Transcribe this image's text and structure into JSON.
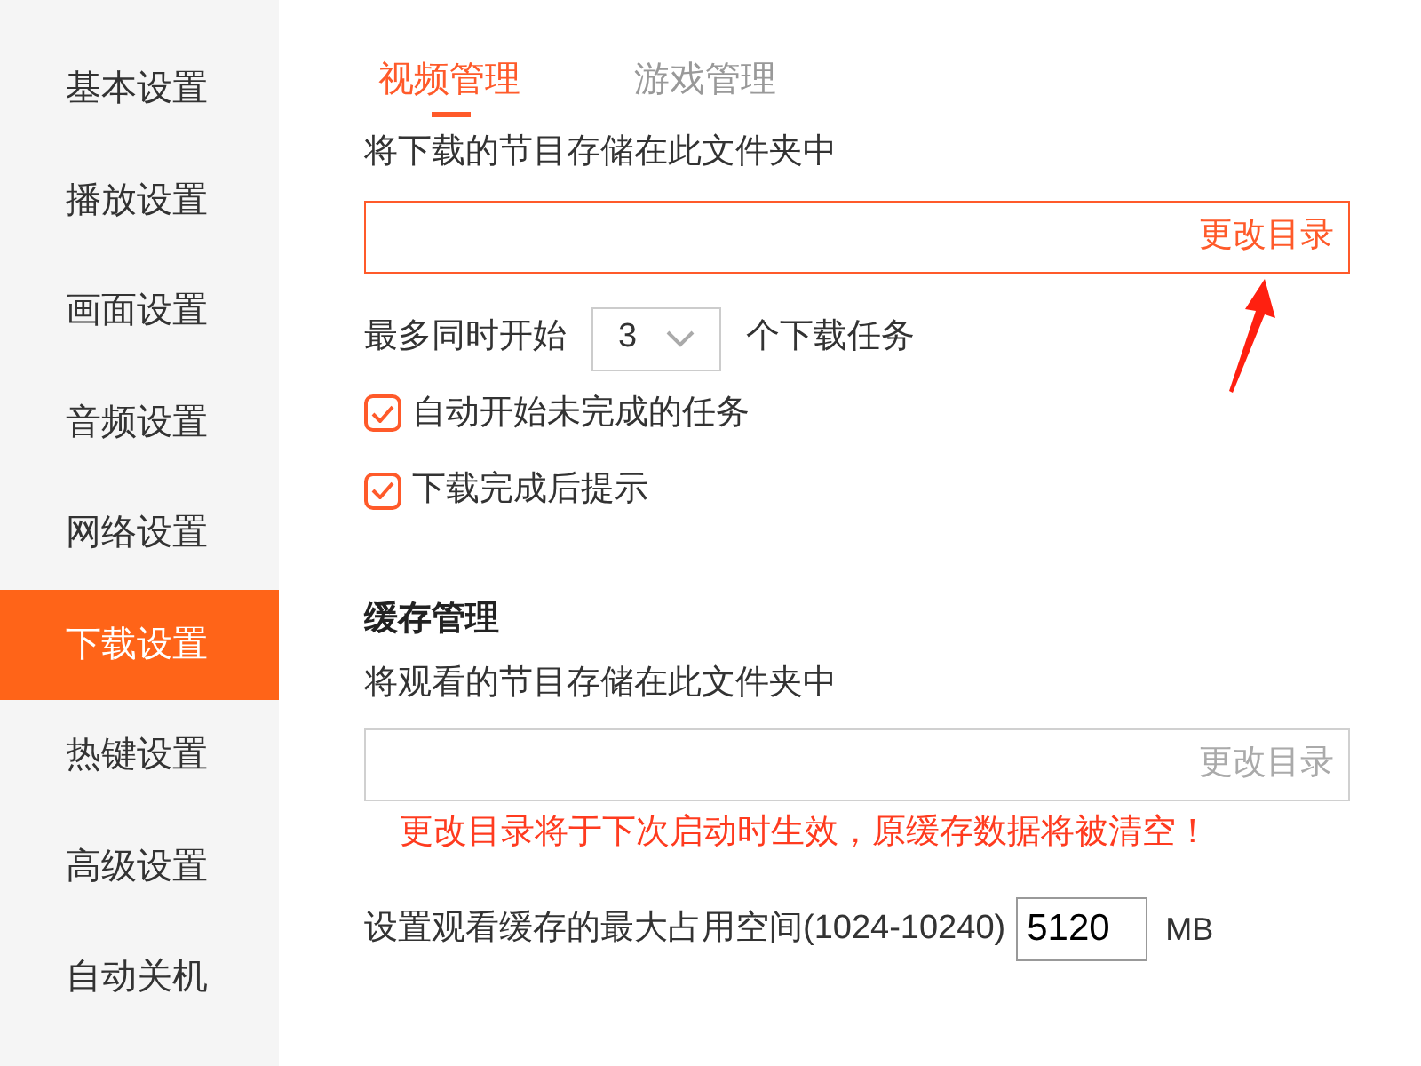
{
  "sidebar": {
    "items": [
      {
        "label": "基本设置",
        "selected": false
      },
      {
        "label": "播放设置",
        "selected": false
      },
      {
        "label": "画面设置",
        "selected": false
      },
      {
        "label": "音频设置",
        "selected": false
      },
      {
        "label": "网络设置",
        "selected": false
      },
      {
        "label": "下载设置",
        "selected": true
      },
      {
        "label": "热键设置",
        "selected": false
      },
      {
        "label": "高级设置",
        "selected": false
      },
      {
        "label": "自动关机",
        "selected": false
      }
    ]
  },
  "tabs": [
    {
      "label": "视频管理",
      "selected": true
    },
    {
      "label": "游戏管理",
      "selected": false
    }
  ],
  "download": {
    "caption": "将下载的节目存储在此文件夹中",
    "folder_button": "更改目录",
    "focused": true,
    "max_label": "最多同时开始",
    "max_value": "3",
    "max_suffix": "个下载任务",
    "options": [
      {
        "label": "自动开始未完成的任务",
        "checked": true
      },
      {
        "label": "下载完成后提示",
        "checked": true
      }
    ]
  },
  "cache": {
    "heading": "缓存管理",
    "caption": "将观看的节目存储在此文件夹中",
    "folder_button": "更改目录",
    "focused": false,
    "warning": "更改目录将于下次启动时生效，原缓存数据将被清空！",
    "size_label": "设置观看缓存的最大占用空间(1024-10240)",
    "size_value": "5120",
    "size_unit": "MB"
  }
}
